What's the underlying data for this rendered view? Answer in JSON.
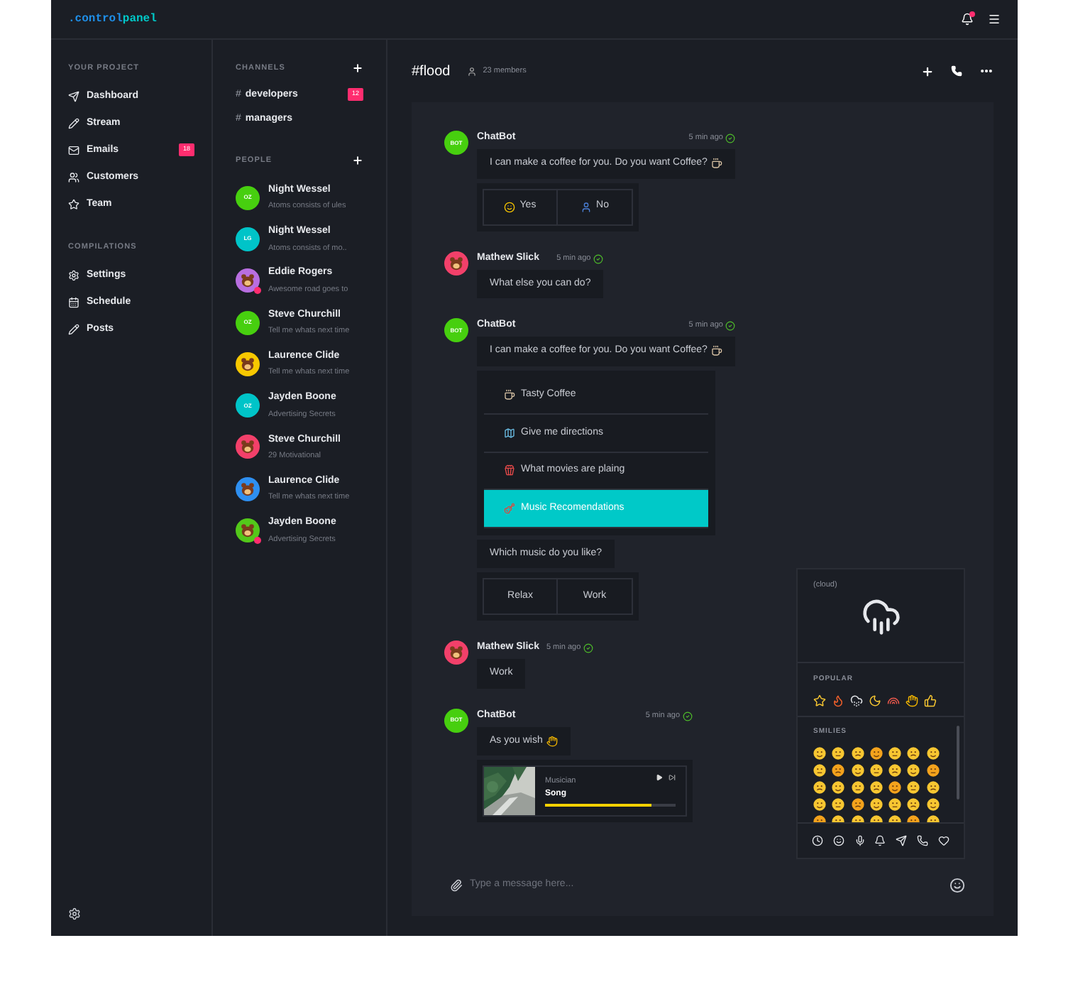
{
  "logo": {
    "prefix": ".control",
    "name": "panel"
  },
  "topbar": {
    "unread": true
  },
  "nav": [
    {
      "title": "YOUR PROJECT",
      "items": [
        {
          "label": "Dashboard"
        },
        {
          "label": "Stream"
        },
        {
          "label": "Emails",
          "badge": "18"
        },
        {
          "label": "Customers"
        },
        {
          "label": "Team"
        }
      ]
    },
    {
      "title": "COMPILATIONS",
      "items": [
        {
          "label": "Settings"
        },
        {
          "label": "Schedule"
        },
        {
          "label": "Posts"
        }
      ]
    }
  ],
  "channels": {
    "title": "CHANNELS",
    "items": [
      {
        "prefix": "#",
        "name": "developers",
        "badge": "12"
      },
      {
        "prefix": "#",
        "name": "managers"
      }
    ]
  },
  "people": {
    "title": "PEOPLE",
    "items": [
      {
        "name": "Night Wessel",
        "status": "Atoms consists of ules",
        "avatar": {
          "kind": "initials",
          "initials": "OZ",
          "color": "#47cf0f"
        },
        "online": false
      },
      {
        "name": "Night Wessel",
        "status": "Atoms consists of mo..",
        "avatar": {
          "kind": "initials",
          "initials": "LG",
          "color": "#00c4c8"
        },
        "online": false
      },
      {
        "name": "Eddie Rogers",
        "status": "Awesome road goes to",
        "avatar": {
          "kind": "picture",
          "color": "#b86ee0"
        },
        "online": true
      },
      {
        "name": "Steve Churchill",
        "status": "Tell me whats next time",
        "avatar": {
          "kind": "initials",
          "initials": "OZ",
          "color": "#47cf0f"
        },
        "online": false
      },
      {
        "name": "Laurence Clide",
        "status": "Tell me whats next time",
        "avatar": {
          "kind": "picture",
          "color": "#f8c800"
        },
        "online": false
      },
      {
        "name": "Jayden Boone",
        "status": "Advertising Secrets",
        "avatar": {
          "kind": "initials",
          "initials": "OZ",
          "color": "#00c4c8"
        },
        "online": false
      },
      {
        "name": "Steve Churchill",
        "status": "29 Motivational",
        "avatar": {
          "kind": "picture",
          "color": "#f2406a"
        },
        "online": false
      },
      {
        "name": "Laurence Clide",
        "status": "Tell me whats next time",
        "avatar": {
          "kind": "picture",
          "color": "#2e8ff0"
        },
        "online": false
      },
      {
        "name": "Jayden Boone",
        "status": "Advertising Secrets",
        "avatar": {
          "kind": "picture",
          "color": "#53c81a"
        },
        "online": true
      }
    ]
  },
  "channel": {
    "name": "#flood",
    "members": "23 members"
  },
  "messages": [
    {
      "author": "ChatBot",
      "time": "5 min ago",
      "verified": true,
      "avatar": {
        "kind": "initials",
        "initials": "BOT",
        "color": "#47cf0f"
      },
      "items": [
        {
          "kind": "text",
          "text": "I can make a coffee for you. Do you want Coffee?"
        },
        {
          "kind": "buttons",
          "buttons": [
            {
              "label": "Yes"
            },
            {
              "label": "No"
            }
          ]
        }
      ]
    },
    {
      "author": "Mathew Slick",
      "time": "5 min ago",
      "verified": true,
      "avatar": {
        "kind": "picture",
        "color": "#f2406a"
      },
      "items": [
        {
          "kind": "text",
          "text": "What else you can do?"
        }
      ]
    },
    {
      "author": "ChatBot",
      "time": "5 min ago",
      "verified": true,
      "avatar": {
        "kind": "initials",
        "initials": "BOT",
        "color": "#47cf0f"
      },
      "items": [
        {
          "kind": "text",
          "text": "I can make a coffee for you. Do you want Coffee?"
        },
        {
          "kind": "menu",
          "options": [
            {
              "label": "Tasty Coffee",
              "selected": false
            },
            {
              "label": "Give me directions",
              "selected": false
            },
            {
              "label": "What movies are plaing",
              "selected": false
            },
            {
              "label": "Music Recomendations",
              "selected": true
            }
          ]
        },
        {
          "kind": "text",
          "text": "Which music do you like?"
        },
        {
          "kind": "buttons",
          "buttons": [
            {
              "label": "Relax"
            },
            {
              "label": "Work"
            }
          ]
        }
      ]
    },
    {
      "author": "Mathew Slick",
      "time": "5 min ago",
      "verified": true,
      "avatar": {
        "kind": "picture",
        "color": "#f2406a"
      },
      "items": [
        {
          "kind": "text",
          "text": "Work"
        }
      ]
    },
    {
      "author": "ChatBot",
      "time": "5 min ago",
      "verified": true,
      "avatar": {
        "kind": "initials",
        "initials": "BOT",
        "color": "#47cf0f"
      },
      "items": [
        {
          "kind": "text",
          "text": "As you wish"
        },
        {
          "kind": "player",
          "artist": "Musician",
          "title": "Song",
          "level": 0.82
        }
      ]
    }
  ],
  "composer": {
    "placeholder": "Type a message here..."
  },
  "emoji_picker": {
    "preview_label": "(cloud)",
    "sections": [
      {
        "title": "POPULAR"
      },
      {
        "title": "SMILIES"
      }
    ]
  }
}
